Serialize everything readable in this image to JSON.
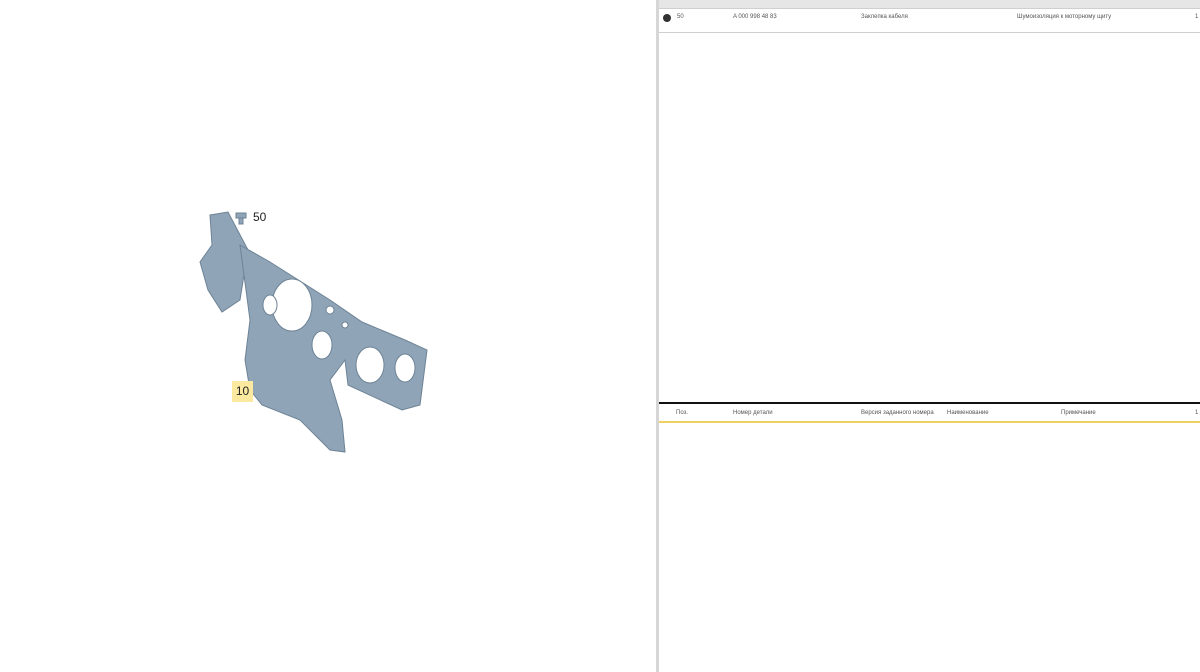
{
  "diagram": {
    "callouts": [
      "10",
      "50"
    ],
    "part_color": "#8ea3b5"
  },
  "parts_table": {
    "rows": [
      {
        "pos": "50",
        "part_number": "A 000 998 48 83",
        "name": "Заклепка кабеля",
        "note": "Шумоизоляция к моторному щиту",
        "qty": "1"
      }
    ],
    "headers": [
      "Поз.",
      "Номер детали",
      "Версия заданного номера",
      "Наименование",
      "Примечание",
      "1"
    ]
  }
}
